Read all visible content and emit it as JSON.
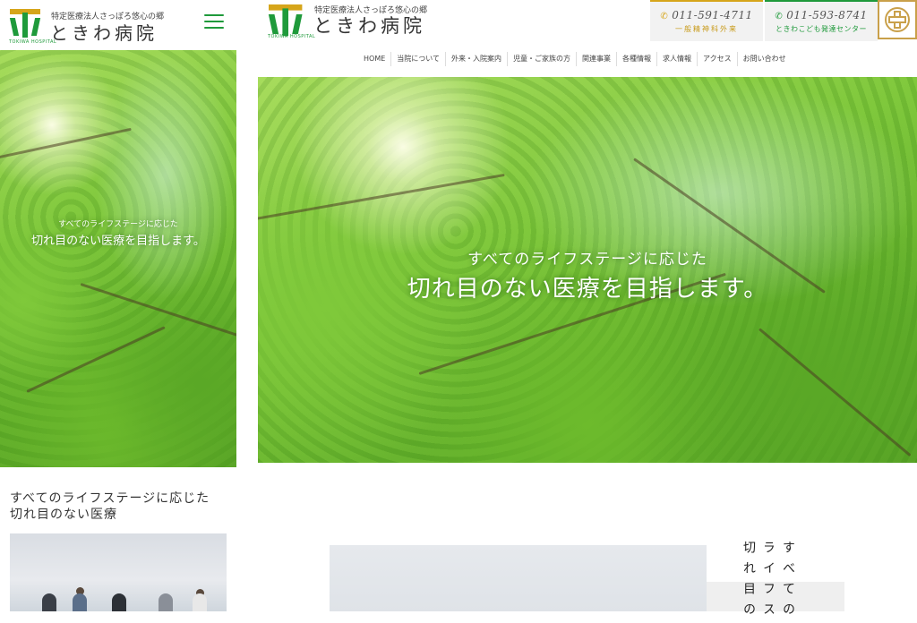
{
  "brand": {
    "subtitle": "特定医療法人さっぽろ悠心の郷",
    "name": "ときわ病院",
    "english": "TOKIWA HOSPITAL"
  },
  "mobile": {
    "hero": {
      "line1": "すべてのライフステージに応じた",
      "line2": "切れ目のない医療を目指します。"
    },
    "section_title_line1": "すべてのライフステージに応じた",
    "section_title_line2": "切れ目のない医療"
  },
  "desktop": {
    "tel": [
      {
        "number": "011-591-4711",
        "label": "一般精神科外来",
        "color": "#d6a51a"
      },
      {
        "number": "011-593-8741",
        "label": "ときわこども発達センター",
        "color": "#1f9a3b"
      }
    ],
    "nav": [
      "HOME",
      "当院について",
      "外来・入院案内",
      "児童・ご家族の方",
      "関連事業",
      "各種情報",
      "求人情報",
      "アクセス",
      "お問い合わせ"
    ],
    "hero": {
      "line1": "すべてのライフステージに応じた",
      "line2": "切れ目のない医療を目指します。"
    },
    "vertical": {
      "col1": "すべての",
      "col2": "ライフス",
      "col3": "切れ目の"
    }
  },
  "colors": {
    "brand_green": "#1f9a3b",
    "brand_gold": "#d6a51a",
    "foliage": "#7cc63a"
  },
  "icons": [
    "hamburger-menu-icon",
    "phone-icon",
    "hospital-cross-badge-icon"
  ]
}
